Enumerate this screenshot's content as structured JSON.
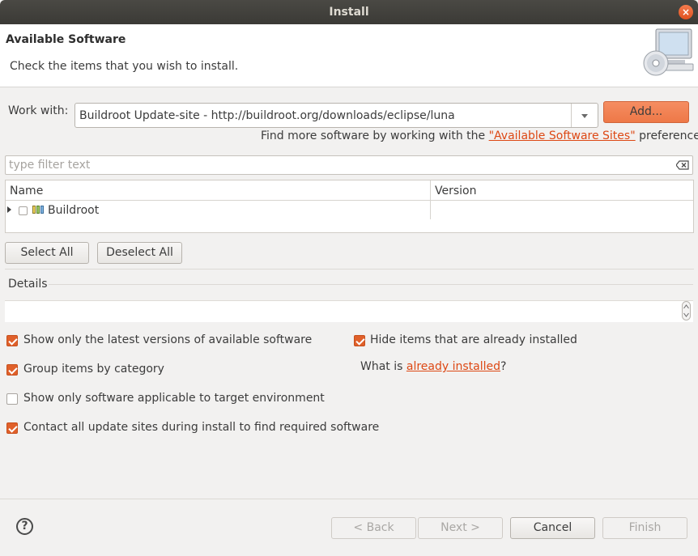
{
  "window": {
    "title": "Install",
    "close_glyph": "×"
  },
  "header": {
    "title": "Available Software",
    "description": "Check the items that you wish to install.",
    "icon": "install-cd-monitor-icon"
  },
  "work_with": {
    "label": "Work with:",
    "value": "Buildroot Update-site - http://buildroot.org/downloads/eclipse/luna",
    "add_label": "Add...",
    "find_more_prefix": "Find more software by working with the ",
    "find_more_link": "\"Available Software Sites\"",
    "find_more_suffix": " preferences."
  },
  "filter": {
    "placeholder": "type filter text"
  },
  "tree": {
    "columns": [
      "Name",
      "Version"
    ],
    "rows": [
      {
        "label": "Buildroot",
        "version": "",
        "checked": false,
        "expanded": false
      }
    ]
  },
  "selection": {
    "select_all": "Select All",
    "deselect_all": "Deselect All"
  },
  "details": {
    "label": "Details"
  },
  "options": {
    "latest_versions": {
      "label": "Show only the latest versions of available software",
      "checked": true
    },
    "group_by_category": {
      "label": "Group items by category",
      "checked": true
    },
    "target_env": {
      "label": "Show only software applicable to target environment",
      "checked": false
    },
    "contact_sites": {
      "label": "Contact all update sites during install to find required software",
      "checked": true
    },
    "hide_installed": {
      "label": "Hide items that are already installed",
      "checked": true
    },
    "what_is_prefix": "What is ",
    "what_is_link": "already installed",
    "what_is_suffix": "?"
  },
  "footer": {
    "help_glyph": "?",
    "back": "< Back",
    "next": "Next >",
    "cancel": "Cancel",
    "finish": "Finish"
  },
  "colors": {
    "accent": "#e0602a",
    "link": "#dd4814",
    "titlebar": "#3f3e3a"
  }
}
